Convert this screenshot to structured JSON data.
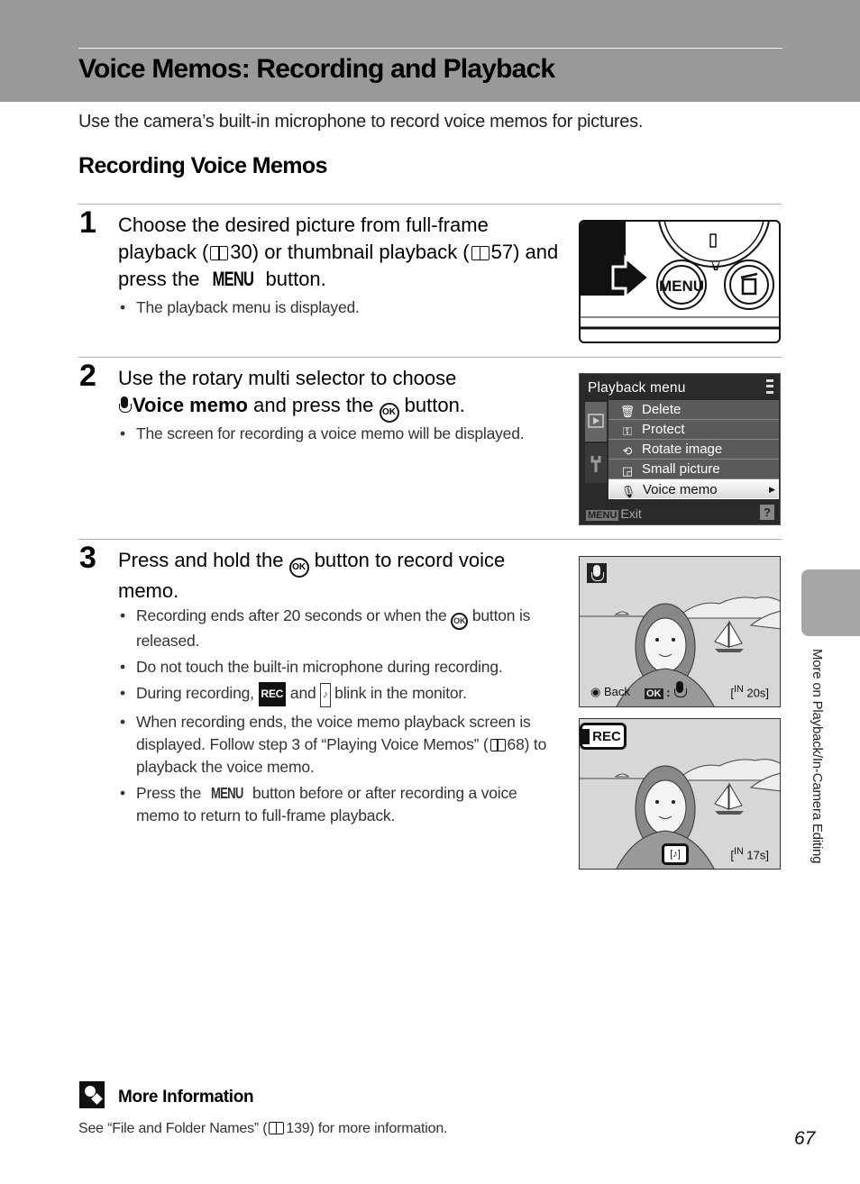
{
  "header": {
    "title": "Voice Memos: Recording and Playback"
  },
  "intro": "Use the camera’s built-in microphone to record voice memos for pictures.",
  "section_title": "Recording Voice Memos",
  "steps": [
    {
      "number": "1",
      "text_parts": [
        "Choose the desired picture from full-frame playback (",
        "30) or thumbnail playback (",
        "57) and press the ",
        "MENU",
        " button."
      ],
      "bullets": [
        "The playback menu is displayed."
      ]
    },
    {
      "number": "2",
      "text_parts": [
        "Use the rotary multi selector to choose ",
        "Voice memo",
        " and press the ",
        "OK",
        " button."
      ],
      "bullets": [
        "The screen for recording a voice memo will be displayed."
      ]
    },
    {
      "number": "3",
      "text_parts": [
        "Press and hold the ",
        "OK",
        " button to record voice memo."
      ],
      "bullets": [
        {
          "parts": [
            "Recording ends after 20 seconds or when the ",
            "OK",
            " button is released."
          ]
        },
        {
          "parts": [
            "Do not touch the built-in microphone during recording."
          ]
        },
        {
          "parts": [
            "During recording, ",
            "REC",
            " and ",
            "♪",
            " blink in the monitor."
          ]
        },
        {
          "parts": [
            "When recording ends, the voice memo playback screen is displayed. Follow step 3 of “Playing Voice Memos” (",
            "68) to playback the voice memo."
          ]
        },
        {
          "parts": [
            "Press the ",
            "MENU",
            " button before or after recording a voice memo to return to full-frame playback."
          ]
        }
      ]
    }
  ],
  "figure_camera": {
    "menu_button_label": "MENU",
    "delete_icon": "trash-icon",
    "macro_icon": "tulip-icon"
  },
  "playback_menu": {
    "title": "Playback menu",
    "items": [
      {
        "icon": "trash-icon",
        "glyph": "🗑",
        "label": "Delete"
      },
      {
        "icon": "key-icon",
        "glyph": "⚿",
        "label": "Protect"
      },
      {
        "icon": "rotate-icon",
        "glyph": "⟲",
        "label": "Rotate image"
      },
      {
        "icon": "small-picture-icon",
        "glyph": "◲",
        "label": "Small picture"
      },
      {
        "icon": "mic-icon",
        "glyph": "🎙",
        "label": "Voice memo",
        "selected": true
      }
    ],
    "footer_menu": "MENU",
    "footer_exit": "Exit",
    "help": "?"
  },
  "screen_record": {
    "back_label": "Back",
    "ok_label": "OK",
    "memory": "IN",
    "time": "20s"
  },
  "screen_recording": {
    "rec_label": "REC",
    "memory": "IN",
    "time": "17s"
  },
  "side_tab": {
    "label": "More on Playback/In-Camera Editing"
  },
  "more_info": {
    "title": "More Information",
    "body_parts": [
      "See “File and Folder Names” (",
      "139) for more information."
    ]
  },
  "page_number": "67"
}
